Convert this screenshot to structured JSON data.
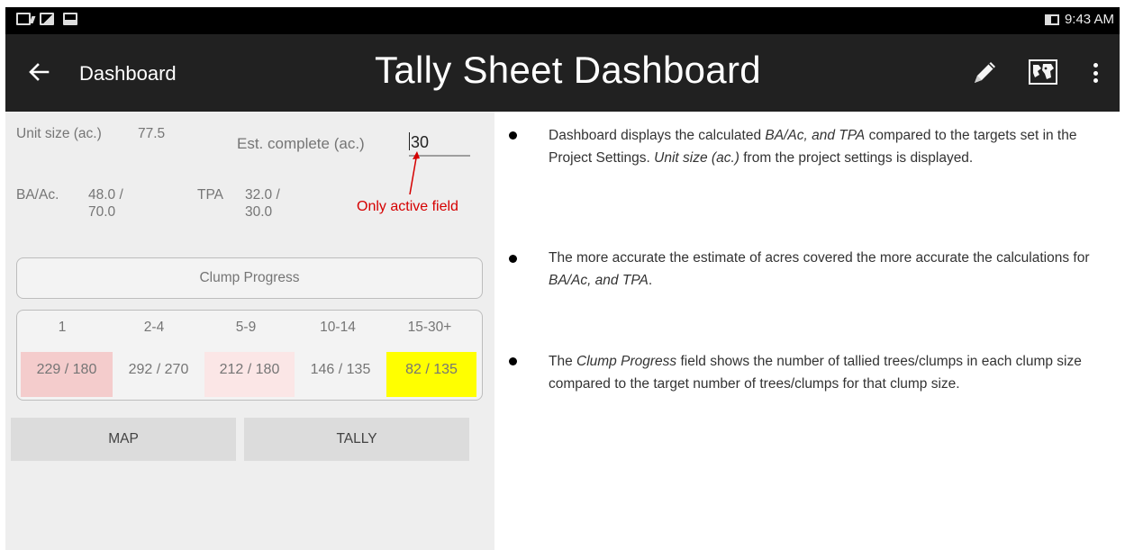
{
  "status_bar": {
    "time": "9:43 AM",
    "icons": [
      "notes-icon",
      "image-icon",
      "inbox-icon",
      "battery-icon"
    ]
  },
  "app_bar": {
    "nav_title": "Dashboard",
    "title": "Tally Sheet Dashboard",
    "actions": [
      "pencil-icon",
      "map-icon",
      "more-vert-icon"
    ]
  },
  "dashboard": {
    "unit_size_label": "Unit size (ac.)",
    "unit_size_value": "77.5",
    "est_complete_label": "Est. complete (ac.)",
    "est_complete_value": "30",
    "ba_label": "BA/Ac.",
    "ba_value_1": "48.0 /",
    "ba_value_2": "70.0",
    "tpa_label": "TPA",
    "tpa_value_1": "32.0 /",
    "tpa_value_2": "30.0",
    "annotation": "Only active field",
    "clump_progress_label": "Clump Progress",
    "clump_headers": [
      "1",
      "2-4",
      "5-9",
      "10-14",
      "15-30+"
    ],
    "clump_values": [
      "229 / 180",
      "292 / 270",
      "212 / 180",
      "146 / 135",
      "82 / 135"
    ],
    "clump_colors": [
      "#f4cccc",
      "#f3f3f3",
      "#fbe6e6",
      "#f3f3f3",
      "#ffff00"
    ],
    "map_button": "MAP",
    "tally_button": "TALLY"
  },
  "notes": {
    "note1_a": "Dashboard displays the calculated ",
    "note1_b": "BA/Ac, and TPA",
    "note1_c": " compared to the targets set in the Project Settings. ",
    "note1_d": "Unit size (ac.)",
    "note1_e": " from the project settings is displayed.",
    "note2_a": "The more accurate the estimate of acres covered the more accurate the calculations for ",
    "note2_b": "BA/Ac, and TPA",
    "note2_c": ".",
    "note3_a": "The ",
    "note3_b": "Clump Progress",
    "note3_c": " field shows the number of tallied trees/clumps in each clump size compared to the target number of trees/clumps for that clump size."
  }
}
